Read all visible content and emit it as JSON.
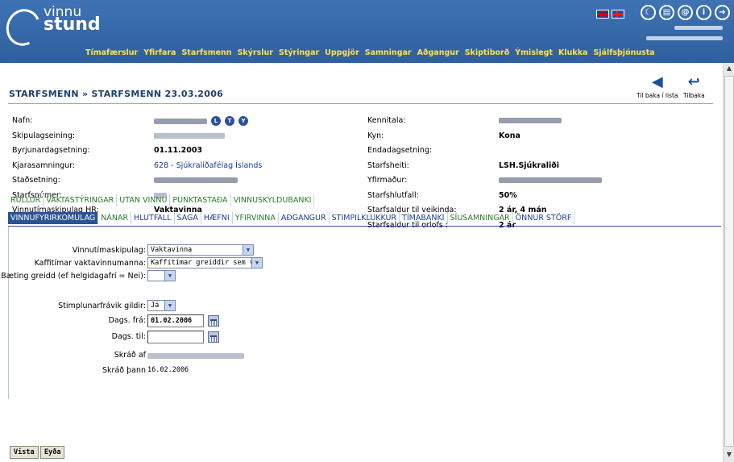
{
  "app": {
    "logo_top": "vinnu",
    "logo_bottom": "stund"
  },
  "nav": [
    "Tímafærslur",
    "Yfirfara",
    "Starfsmenn",
    "Skýrslur",
    "Stýringar",
    "Uppgjör",
    "Samningar",
    "Aðgangur",
    "Skiptiborð",
    "Ýmislegt",
    "Klukka",
    "Sjálfsþjónusta"
  ],
  "top_icons": {
    "moon": "☾",
    "print": "▤",
    "mail": "@",
    "info": "i",
    "logout": "➜"
  },
  "page": {
    "title": "STARFSMENN » STARFSMENN 23.03.2006",
    "back_to_list": "Til baka í lista",
    "back": "Tilbaka"
  },
  "info_left": [
    {
      "label": "Nafn:",
      "value": ""
    },
    {
      "label": "Skipulagseining:",
      "value": ""
    },
    {
      "label": "Byrjunardagsetning:",
      "value": "01.11.2003"
    },
    {
      "label": "Kjarasamningur:",
      "value": "628 - Sjúkraliðafélag Íslands"
    },
    {
      "label": "Staðsetning:",
      "value": ""
    },
    {
      "label": "Starfsnúmer:",
      "value": ""
    },
    {
      "label": "Vinnutímaskipulag HR:",
      "value": "Vaktavinna"
    }
  ],
  "info_right": [
    {
      "label": "Kennitala:",
      "value": ""
    },
    {
      "label": "Kyn:",
      "value": "Kona"
    },
    {
      "label": "Endadagsetning:",
      "value": ""
    },
    {
      "label": "Starfsheiti:",
      "value": "LSH.Sjúkraliði"
    },
    {
      "label": "Yfirmaður:",
      "value": ""
    },
    {
      "label": "Starfshlutfall:",
      "value": "50%"
    },
    {
      "label": "Starfsaldur til veikinda:",
      "value": "2 ár, 4 mán"
    },
    {
      "label": "Starfsaldur til orlofs :",
      "value": "2 ár"
    }
  ],
  "name_badges": [
    "L",
    "T",
    "Y"
  ],
  "tabs_row1": [
    "RÚLLUR",
    "VAKTASTÝRINGAR",
    "UTAN VINNU",
    "PUNKTASTAÐA",
    "VINNUSKYLDUBANKI"
  ],
  "tabs_row2": [
    "VINNUFYRIRKOMULAG",
    "NÁNAR",
    "HLUTFALL",
    "SAGA",
    "HÆFNI",
    "YFIRVINNA",
    "AÐGANGUR",
    "STIMPILKLUKKUR",
    "TÍMABANKI",
    "SÍUSAMNINGAR",
    "ÖNNUR STÖRF"
  ],
  "form": {
    "vinnutimaskipulag_label": "Vinnutímaskipulag:",
    "vinnutimaskipulag_value": "Vaktavinna",
    "kaffitimar_label": "Kaffitímar vaktavinnumanna:",
    "kaffitimar_value": "Kaffitímar greiddir sem viðbót",
    "baeting_label": "Bæting greidd (ef helgidagafrí = Nei):",
    "baeting_value": "",
    "stimplun_label": "Stimplunarfrávik gildir:",
    "stimplun_value": "Já",
    "dags_fra_label": "Dags. frá:",
    "dags_fra_value": "01.02.2006",
    "dags_til_label": "Dags. til:",
    "dags_til_value": "",
    "skrad_af_label": "Skráð af",
    "skrad_thann_label": "Skráð þann",
    "skrad_thann_value": "16.02.2006"
  },
  "buttons": {
    "save": "Vista",
    "delete": "Eyða"
  }
}
